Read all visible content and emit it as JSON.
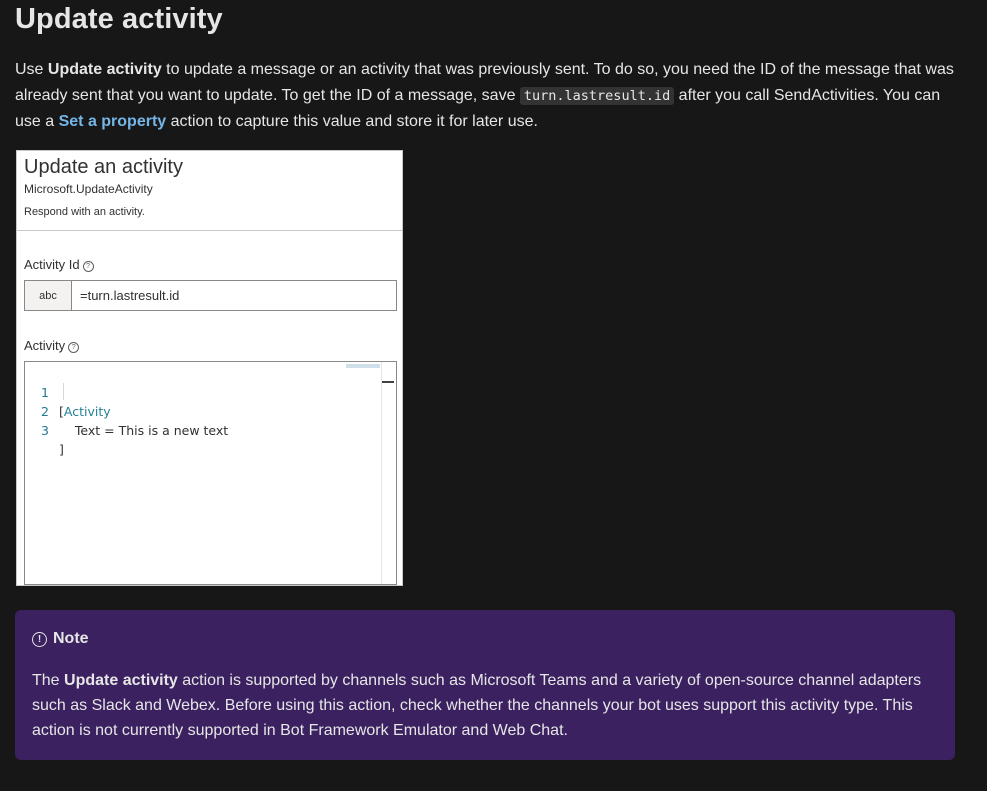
{
  "heading": "Update activity",
  "intro": {
    "t1": "Use ",
    "b1": "Update activity",
    "t2": " to update a message or an activity that was previously sent. To do so, you need the ID of the message that was already sent that you want to update. To get the ID of a message, save ",
    "code": "turn.lastresult.id",
    "t3": " after you call SendActivities. You can use a ",
    "link": "Set a property",
    "t4": " action to capture this value and store it for later use."
  },
  "panel": {
    "title": "Update an activity",
    "subtitle": "Microsoft.UpdateActivity",
    "description": "Respond with an activity.",
    "activity_id_label": "Activity Id",
    "help_glyph": "?",
    "type_button": "abc",
    "activity_id_value": "=turn.lastresult.id",
    "activity_label": "Activity",
    "code_lines": [
      {
        "num": "1",
        "pre": "[",
        "kw": "Activity",
        "post": ""
      },
      {
        "num": "2",
        "pre": "    Text = This is a new text",
        "kw": "",
        "post": ""
      },
      {
        "num": "3",
        "pre": "]",
        "kw": "",
        "post": ""
      }
    ]
  },
  "note": {
    "icon_glyph": "!",
    "title": "Note",
    "t1": "The ",
    "b1": "Update activity",
    "t2": " action is supported by channels such as Microsoft Teams and a variety of open-source channel adapters such as Slack and Webex. Before using this action, check whether the channels your bot uses support this activity type. This action is not currently supported in Bot Framework Emulator and Web Chat."
  },
  "colors": {
    "background": "#171717",
    "link": "#75b6e7",
    "note_background": "#3b2160"
  }
}
